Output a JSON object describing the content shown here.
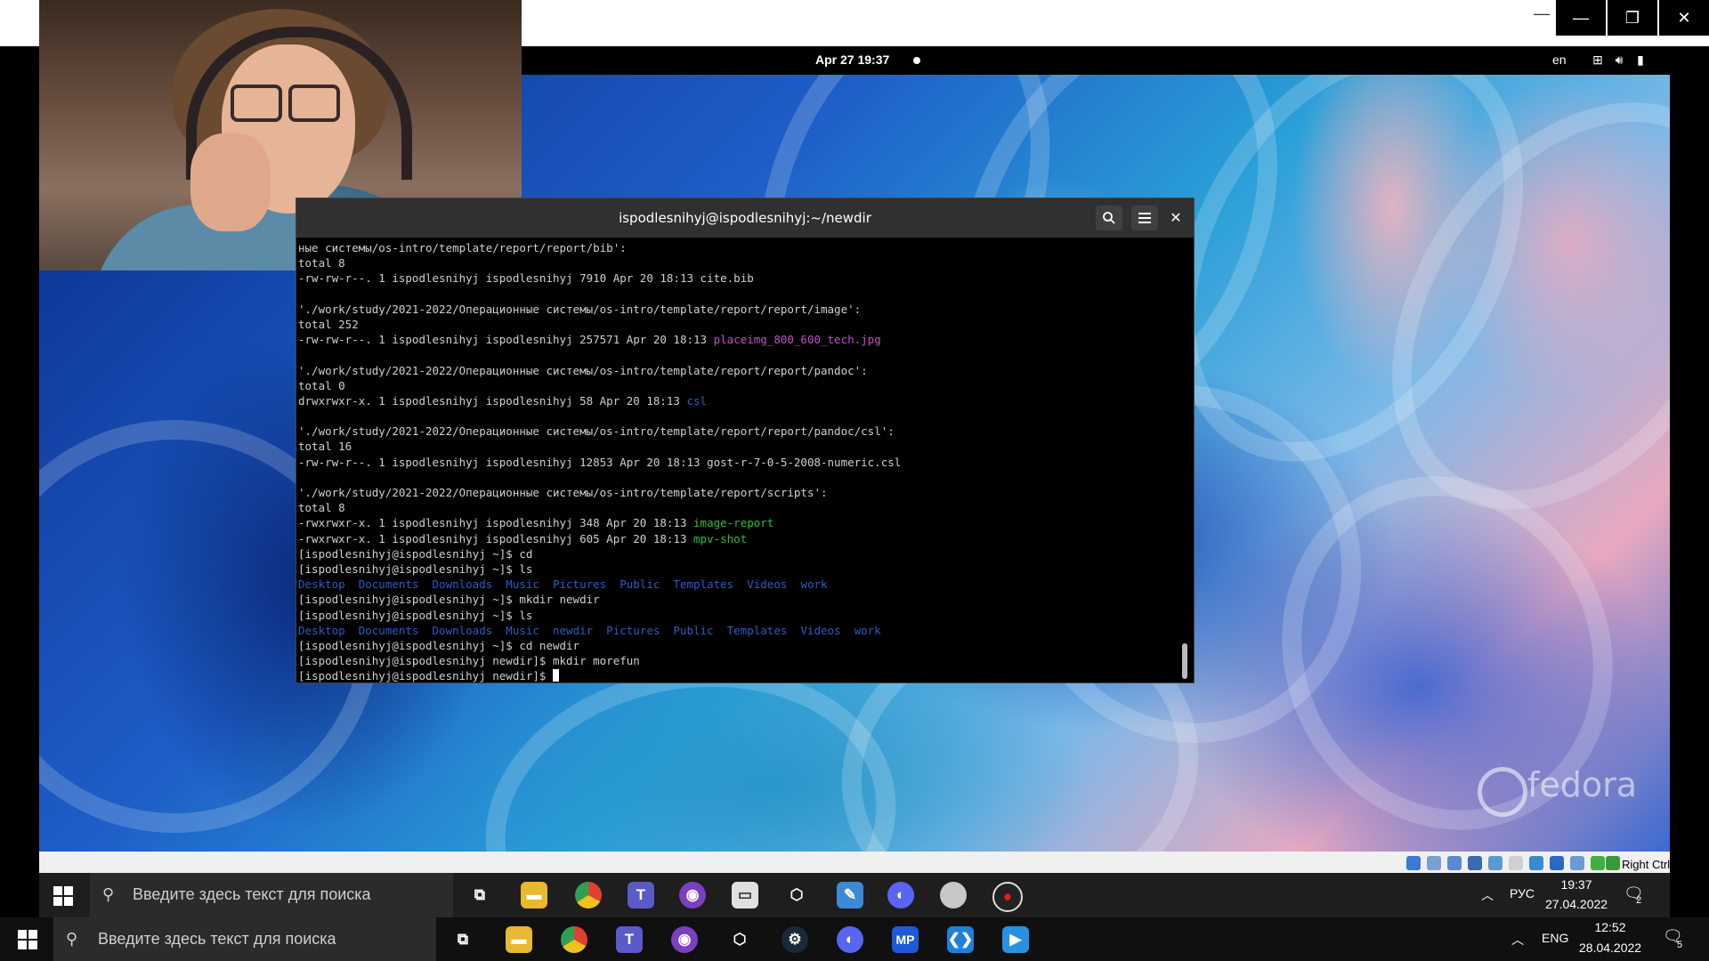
{
  "host": {
    "window_buttons": {
      "minimize": "—",
      "restore": "❐",
      "close": "✕"
    }
  },
  "gnome": {
    "clock": "Apr 27  19:37",
    "lang": "en",
    "tray_icons": [
      "network-icon",
      "volume-icon",
      "battery-icon"
    ]
  },
  "terminal": {
    "title": "ispodlesnihyj@ispodlesnihyj:~/newdir",
    "lines": [
      [
        {
          "t": "ные системы/os-intro/template/report/report/bib':",
          "c": "#d0d0d0"
        }
      ],
      [
        {
          "t": "total 8",
          "c": "#d0d0d0"
        }
      ],
      [
        {
          "t": "-rw-rw-r--. 1 ispodlesnihyj ispodlesnihyj 7910 Apr 20 18:13 cite.bib",
          "c": "#d0d0d0"
        }
      ],
      [
        {
          "t": "",
          "c": "#d0d0d0"
        }
      ],
      [
        {
          "t": "'./work/study/2021-2022/Операционные системы/os-intro/template/report/report/image':",
          "c": "#d0d0d0"
        }
      ],
      [
        {
          "t": "total 252",
          "c": "#d0d0d0"
        }
      ],
      [
        {
          "t": "-rw-rw-r--. 1 ispodlesnihyj ispodlesnihyj 257571 Apr 20 18:13 ",
          "c": "#d0d0d0"
        },
        {
          "t": "placeimg_800_600_tech.jpg",
          "c": "#c050c8"
        }
      ],
      [
        {
          "t": "",
          "c": "#d0d0d0"
        }
      ],
      [
        {
          "t": "'./work/study/2021-2022/Операционные системы/os-intro/template/report/report/pandoc':",
          "c": "#d0d0d0"
        }
      ],
      [
        {
          "t": "total 0",
          "c": "#d0d0d0"
        }
      ],
      [
        {
          "t": "drwxrwxr-x. 1 ispodlesnihyj ispodlesnihyj 58 Apr 20 18:13 ",
          "c": "#d0d0d0"
        },
        {
          "t": "csl",
          "c": "#2a5cc8"
        }
      ],
      [
        {
          "t": "",
          "c": "#d0d0d0"
        }
      ],
      [
        {
          "t": "'./work/study/2021-2022/Операционные системы/os-intro/template/report/report/pandoc/csl':",
          "c": "#d0d0d0"
        }
      ],
      [
        {
          "t": "total 16",
          "c": "#d0d0d0"
        }
      ],
      [
        {
          "t": "-rw-rw-r--. 1 ispodlesnihyj ispodlesnihyj 12853 Apr 20 18:13 gost-r-7-0-5-2008-numeric.csl",
          "c": "#d0d0d0"
        }
      ],
      [
        {
          "t": "",
          "c": "#d0d0d0"
        }
      ],
      [
        {
          "t": "'./work/study/2021-2022/Операционные системы/os-intro/template/report/scripts':",
          "c": "#d0d0d0"
        }
      ],
      [
        {
          "t": "total 8",
          "c": "#d0d0d0"
        }
      ],
      [
        {
          "t": "-rwxrwxr-x. 1 ispodlesnihyj ispodlesnihyj 348 Apr 20 18:13 ",
          "c": "#d0d0d0"
        },
        {
          "t": "image-report",
          "c": "#30c030"
        }
      ],
      [
        {
          "t": "-rwxrwxr-x. 1 ispodlesnihyj ispodlesnihyj 605 Apr 20 18:13 ",
          "c": "#d0d0d0"
        },
        {
          "t": "mpv-shot",
          "c": "#30c030"
        }
      ],
      [
        {
          "t": "[ispodlesnihyj@ispodlesnihyj ~]$ cd",
          "c": "#d0d0d0"
        }
      ],
      [
        {
          "t": "[ispodlesnihyj@ispodlesnihyj ~]$ ls",
          "c": "#d0d0d0"
        }
      ],
      [
        {
          "t": "Desktop  Documents  Downloads  Music  Pictures  Public  Templates  Videos  work",
          "c": "#2a5cc8"
        }
      ],
      [
        {
          "t": "[ispodlesnihyj@ispodlesnihyj ~]$ mkdir newdir",
          "c": "#d0d0d0"
        }
      ],
      [
        {
          "t": "[ispodlesnihyj@ispodlesnihyj ~]$ ls",
          "c": "#d0d0d0"
        }
      ],
      [
        {
          "t": "Desktop  Documents  Downloads  Music  newdir  Pictures  Public  Templates  Videos  work",
          "c": "#2a5cc8"
        }
      ],
      [
        {
          "t": "[ispodlesnihyj@ispodlesnihyj ~]$ cd newdir",
          "c": "#d0d0d0"
        }
      ],
      [
        {
          "t": "[ispodlesnihyj@ispodlesnihyj newdir]$ mkdir morefun",
          "c": "#d0d0d0"
        }
      ],
      [
        {
          "t": "[ispodlesnihyj@ispodlesnihyj newdir]$ ",
          "c": "#d0d0d0"
        }
      ]
    ]
  },
  "fedora": {
    "logo_text": "fedora"
  },
  "vbox": {
    "right_ctrl": "Right Ctrl"
  },
  "guest_taskbar": {
    "search_placeholder": "Введите здесь текст для поиска",
    "lang": "РУС",
    "time": "19:37",
    "date": "27.04.2022",
    "notifications": "2",
    "icons": [
      "task-view-icon",
      "file-explorer-icon",
      "chrome-icon",
      "teams-icon",
      "github-icon",
      "drive-icon",
      "virtualbox-icon",
      "paint-icon",
      "discord-icon",
      "app-icon",
      "obs-icon"
    ]
  },
  "host_taskbar": {
    "search_placeholder": "Введите здесь текст для поиска",
    "lang": "ENG",
    "time": "12:52",
    "date": "28.04.2022",
    "notifications": "5",
    "icons": [
      "task-view-icon",
      "file-explorer-icon",
      "chrome-icon",
      "teams-icon",
      "github-icon",
      "virtualbox-icon",
      "steam-icon",
      "discord-icon",
      "mp-icon",
      "vscode-icon",
      "media-icon"
    ],
    "mp_label": "MP"
  }
}
